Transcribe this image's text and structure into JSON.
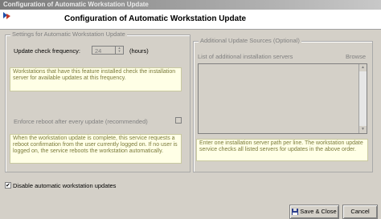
{
  "window": {
    "title": "Configuration of Automatic Workstation Update"
  },
  "header": {
    "title": "Configuration of Automatic Workstation Update",
    "icon": "app-icon"
  },
  "settings": {
    "group_label": "Settings for Automatic Workstation Update",
    "frequency_label": "Update check frequency:",
    "frequency_value": "24",
    "frequency_unit": "(hours)",
    "frequency_note": "Workstations that have this feature installed check the installation server for available updates at this frequency.",
    "reboot_label": "Enforce reboot after every update (recommended)",
    "reboot_checked": false,
    "reboot_note": "When the workstation update is complete, this service requests a reboot confirmation from the user currently logged on. If no user is logged on, the service reboots the workstation automatically."
  },
  "sources": {
    "group_label": "Additional Update Sources (Optional)",
    "list_label": "List of additional installation servers",
    "browse_label": "Browse",
    "servers": [],
    "note": "Enter one installation server path per line. The workstation update service checks all listed servers for updates in the above order."
  },
  "disable": {
    "label": "Disable automatic workstation updates",
    "checked": true,
    "check_glyph": "✔"
  },
  "buttons": {
    "save_close": "Save & Close",
    "cancel": "Cancel"
  },
  "colors": {
    "note_bg": "#ffffe6",
    "note_text": "#7a7a3a",
    "dialog_bg": "#d4d0c8"
  }
}
